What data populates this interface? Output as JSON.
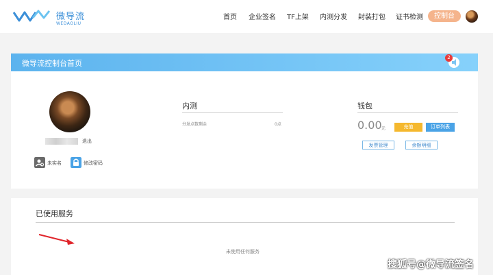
{
  "brand": {
    "name_cn": "微导流",
    "name_en": "WEDAOLIU",
    "color": "#3b8fd8"
  },
  "nav": {
    "items": [
      "首页",
      "企业签名",
      "TF上架",
      "内测分发",
      "封装打包",
      "证书检测"
    ],
    "console_label": "控制台",
    "console_color": "#f5b48c"
  },
  "panel": {
    "title": "微导流控制台首页",
    "notification_count": "2"
  },
  "user": {
    "logout_label": "退出",
    "quick_actions": [
      {
        "label": "未实名",
        "icon": "user-unverified-icon"
      },
      {
        "label": "修改密码",
        "icon": "lock-icon"
      }
    ]
  },
  "beta": {
    "title": "内测",
    "remaining_label": "分发点数剩余",
    "remaining_value": "0点"
  },
  "wallet": {
    "title": "钱包",
    "balance": "0.00",
    "unit": "元",
    "recharge_label": "充值",
    "orders_label": "订单列表",
    "invoice_label": "发票管理",
    "detail_label": "余额明细",
    "recharge_color": "#f5b82e",
    "orders_color": "#4aa3e6"
  },
  "services": {
    "title": "已使用服务",
    "empty_text": "未使用任何服务"
  },
  "watermark": "搜狐号@微导流签名"
}
